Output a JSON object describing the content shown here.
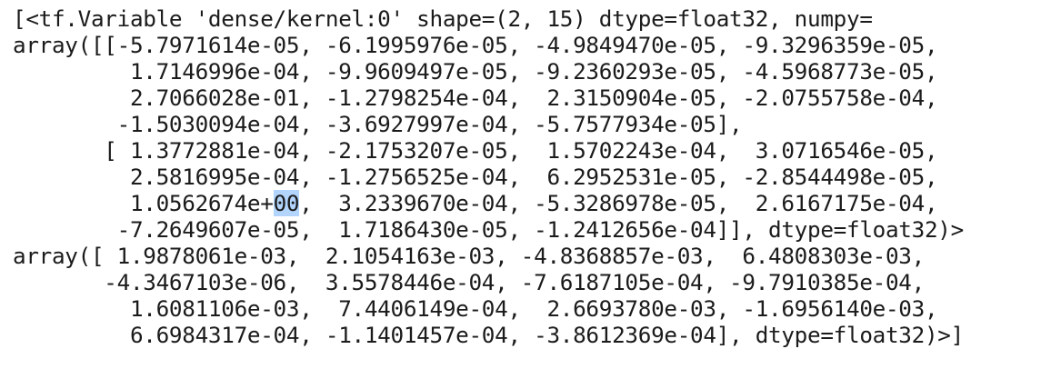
{
  "output": {
    "lines": [
      "[<tf.Variable 'dense/kernel:0' shape=(2, 15) dtype=float32, numpy=",
      "array([[-5.7971614e-05, -6.1995976e-05, -4.9849470e-05, -9.3296359e-05,",
      "         1.7146996e-04, -9.9609497e-05, -9.2360293e-05, -4.5968773e-05,",
      "         2.7066028e-01, -1.2798254e-04,  2.3150904e-05, -2.0755758e-04,",
      "        -1.5030094e-04, -3.6927997e-04, -5.7577934e-05],",
      "       [ 1.3772881e-04, -2.1753207e-05,  1.5702243e-04,  3.0716546e-05,",
      "         2.5816995e-04, -1.2756525e-04,  6.2952531e-05, -2.8544498e-05,",
      "         1.0562674e+",
      "00",
      ",  3.2339670e-04, -5.3286978e-05,  2.6167175e-04,",
      "        -7.2649607e-05,  1.7186430e-05, -1.2412656e-04]], dtype=float32)>",
      "array([ 1.9878061e-03,  2.1054163e-03, -4.8368857e-03,  6.4808303e-03,",
      "       -4.3467103e-06,  3.5578446e-04, -7.6187105e-04, -9.7910385e-04,",
      "         1.6081106e-03,  7.4406149e-04,  2.6693780e-03, -1.6956140e-03,",
      "         6.6984317e-04, -1.1401457e-04, -3.8612369e-04], dtype=float32)>]"
    ]
  }
}
